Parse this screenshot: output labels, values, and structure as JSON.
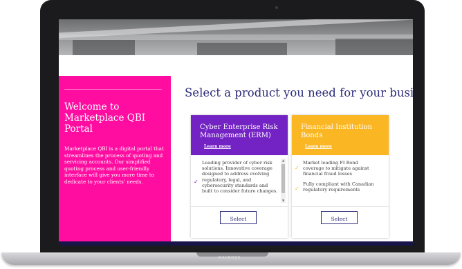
{
  "device": {
    "brand": "MACBOOK"
  },
  "welcome": {
    "title": "Welcome to Marketplace QBI Portal",
    "body": "Marketplace QBI is a digital portal that streamlines the process of quoting and servicing accounts. Our simplified quoting process and user-friendly interface will give you more time to dedicate to your clients' needs."
  },
  "heading": "Select a product you need for your business.",
  "products": [
    {
      "name": "Cyber Enterprise Risk Management (ERM)",
      "learn_more": "Learn more",
      "features": [
        "Leading provider of cyber risk solutions. Innovative coverage designed to address evolving regulatory, legal, and cybersecurity standards and built to consider future changes."
      ],
      "select_label": "Select",
      "color": "#7322c4"
    },
    {
      "name": "Financial Institution Bonds",
      "learn_more": "Learn more",
      "features": [
        "Market leading FI Bond coverage to mitigate against financial fraud losses",
        "Fully compliant with Canadian regulatory requirements"
      ],
      "select_label": "Select",
      "color": "#fbb623"
    }
  ],
  "colors": {
    "pink": "#ff0da0",
    "navy": "#2b2a7a",
    "footer": "#18144a"
  }
}
